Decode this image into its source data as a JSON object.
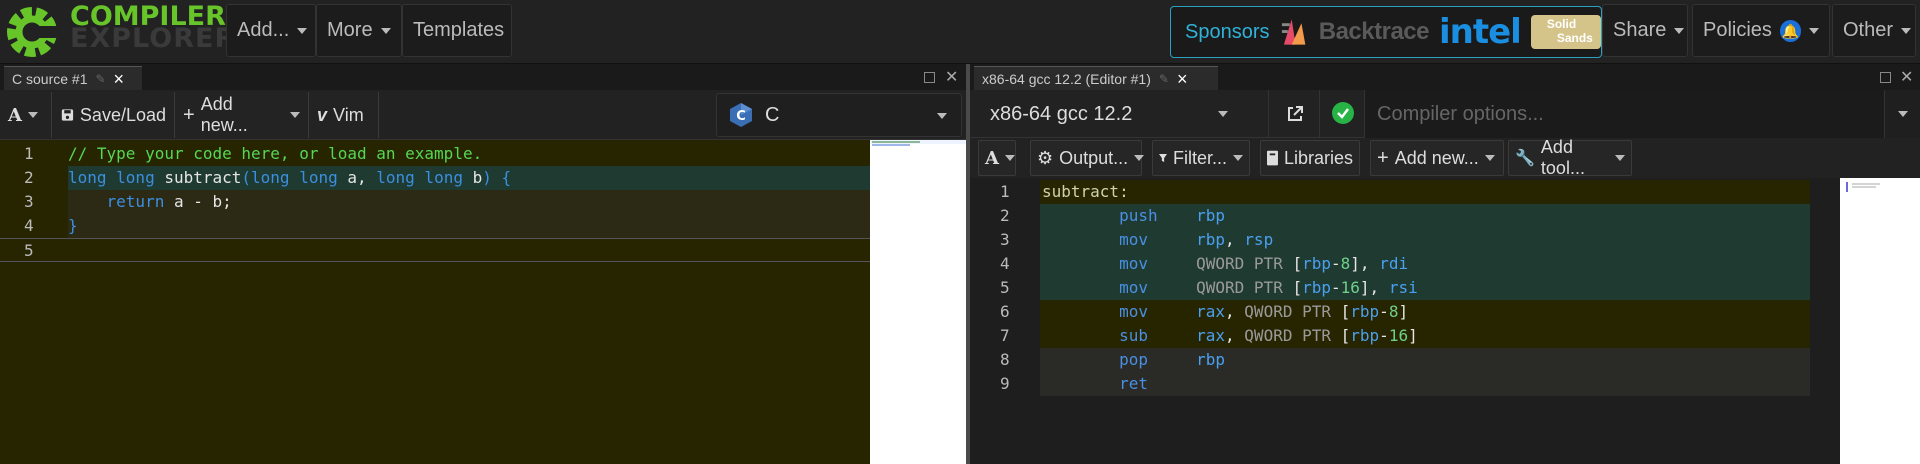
{
  "navbar": {
    "logo_line1": "COMPILER",
    "logo_line2": "EXPLORER",
    "add_label": "Add...",
    "more_label": "More",
    "templates_label": "Templates",
    "sponsors_label": "Sponsors",
    "sponsor_backtrace": "Backtrace",
    "sponsor_intel": "intel",
    "sponsor_solid": "Solid",
    "sponsor_sands": "Sands",
    "share_label": "Share",
    "policies_label": "Policies",
    "policies_badge": "🔔",
    "other_label": "Other",
    "accent": "#67c52a",
    "sponsor_accent": "#2fb2d6"
  },
  "left_pane": {
    "tab_title": "C source #1",
    "toolbar": {
      "font_label": "A",
      "save_label": "Save/Load",
      "add_new_label": "Add new...",
      "vim_label": "Vim",
      "language": "C"
    },
    "lines": [
      {
        "n": "1",
        "tokens": [
          [
            "// Type your code here, or load an example.",
            "comment"
          ]
        ]
      },
      {
        "n": "2",
        "tokens": [
          [
            "long long ",
            "kw"
          ],
          [
            "subtract",
            "id"
          ],
          [
            "(",
            "kw"
          ],
          [
            "long long ",
            "kw"
          ],
          [
            "a",
            "id"
          ],
          [
            ", ",
            "id"
          ],
          [
            "long long ",
            "kw"
          ],
          [
            "b",
            "id"
          ],
          [
            ") {",
            "kw"
          ]
        ]
      },
      {
        "n": "3",
        "tokens": [
          [
            "    return ",
            "kw"
          ],
          [
            "a - b;",
            "id"
          ]
        ]
      },
      {
        "n": "4",
        "tokens": [
          [
            "}",
            "kw"
          ]
        ]
      },
      {
        "n": "5",
        "tokens": []
      }
    ]
  },
  "right_pane": {
    "tab_title": "x86-64 gcc 12.2 (Editor #1)",
    "compiler": "x86-64 gcc 12.2",
    "options_placeholder": "Compiler options...",
    "toolbar": {
      "font_label": "A",
      "output_label": "Output...",
      "filter_label": "Filter...",
      "libraries_label": "Libraries",
      "add_new_label": "Add new...",
      "add_tool_label": "Add tool..."
    },
    "lines": [
      {
        "n": "1",
        "tokens": [
          [
            "subtract:",
            "label"
          ]
        ]
      },
      {
        "n": "2",
        "tokens": [
          [
            "        push    ",
            "inst"
          ],
          [
            "rbp",
            "reg"
          ]
        ]
      },
      {
        "n": "3",
        "tokens": [
          [
            "        mov     ",
            "inst"
          ],
          [
            "rbp",
            "reg"
          ],
          [
            ", ",
            "id"
          ],
          [
            "rsp",
            "reg"
          ]
        ]
      },
      {
        "n": "4",
        "tokens": [
          [
            "        mov     ",
            "inst"
          ],
          [
            "QWORD PTR ",
            "ptr"
          ],
          [
            "[",
            "id"
          ],
          [
            "rbp",
            "reg"
          ],
          [
            "-",
            "id"
          ],
          [
            "8",
            "num"
          ],
          [
            "], ",
            "id"
          ],
          [
            "rdi",
            "reg"
          ]
        ]
      },
      {
        "n": "5",
        "tokens": [
          [
            "        mov     ",
            "inst"
          ],
          [
            "QWORD PTR ",
            "ptr"
          ],
          [
            "[",
            "id"
          ],
          [
            "rbp",
            "reg"
          ],
          [
            "-",
            "id"
          ],
          [
            "16",
            "num"
          ],
          [
            "], ",
            "id"
          ],
          [
            "rsi",
            "reg"
          ]
        ]
      },
      {
        "n": "6",
        "tokens": [
          [
            "        mov     ",
            "inst"
          ],
          [
            "rax",
            "reg"
          ],
          [
            ", ",
            "id"
          ],
          [
            "QWORD PTR ",
            "ptr"
          ],
          [
            "[",
            "id"
          ],
          [
            "rbp",
            "reg"
          ],
          [
            "-",
            "id"
          ],
          [
            "8",
            "num"
          ],
          [
            "]",
            "id"
          ]
        ]
      },
      {
        "n": "7",
        "tokens": [
          [
            "        sub     ",
            "inst"
          ],
          [
            "rax",
            "reg"
          ],
          [
            ", ",
            "id"
          ],
          [
            "QWORD PTR ",
            "ptr"
          ],
          [
            "[",
            "id"
          ],
          [
            "rbp",
            "reg"
          ],
          [
            "-",
            "id"
          ],
          [
            "16",
            "num"
          ],
          [
            "]",
            "id"
          ]
        ]
      },
      {
        "n": "8",
        "tokens": [
          [
            "        pop     ",
            "inst"
          ],
          [
            "rbp",
            "reg"
          ]
        ]
      },
      {
        "n": "9",
        "tokens": [
          [
            "        ret",
            "inst"
          ]
        ]
      }
    ]
  },
  "colors": {
    "editor_bg": "#272400",
    "highlight_green": "#1f3a31",
    "highlight_olive": "#2c2a15",
    "success": "#28b346",
    "intel_blue": "#1a8ee0"
  }
}
